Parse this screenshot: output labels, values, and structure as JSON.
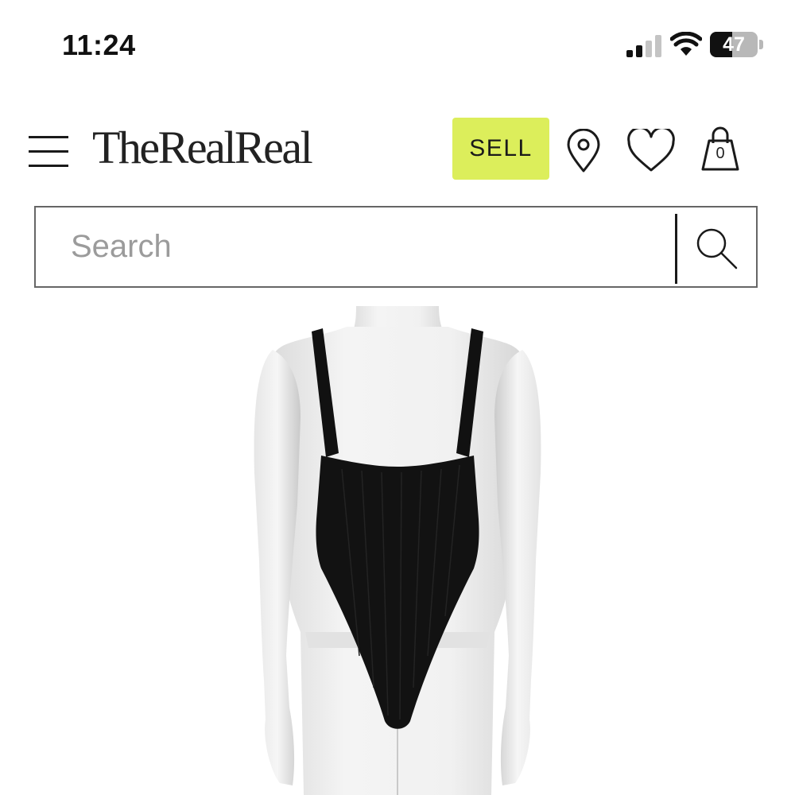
{
  "status_bar": {
    "time": "11:24",
    "battery_level": "47",
    "battery_fraction": 0.47,
    "icons": [
      "signal-icon",
      "wifi-icon",
      "battery-icon"
    ]
  },
  "header": {
    "menu_icon": "hamburger-menu-icon",
    "logo_text": "TheRealReal",
    "sell_label": "SELL",
    "location_icon": "location-pin-icon",
    "favorites_icon": "heart-icon",
    "bag_icon": "shopping-bag-icon",
    "bag_count": "0"
  },
  "search": {
    "placeholder": "Search",
    "value": "",
    "icon": "search-icon"
  },
  "product": {
    "image": "black ribbed bodysuit on mannequin, back view"
  },
  "colors": {
    "sell_accent": "#dcee5b",
    "text": "#1a1a1a",
    "placeholder": "#9b9b9b",
    "background": "#ffffff"
  }
}
